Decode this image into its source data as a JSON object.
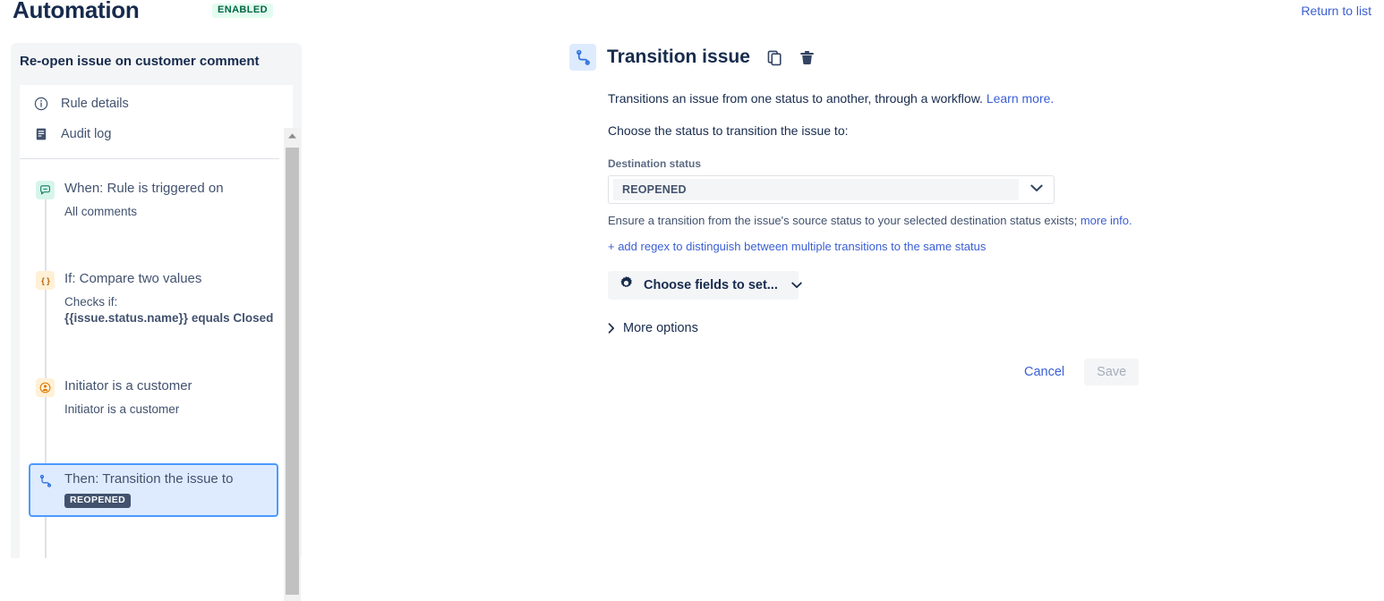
{
  "header": {
    "title": "Automation",
    "status_badge": "ENABLED",
    "return_link": "Return to list"
  },
  "sidebar": {
    "rule_name": "Re-open issue on customer comment",
    "nav": [
      {
        "label": "Rule details",
        "icon": "info-circle-icon"
      },
      {
        "label": "Audit log",
        "icon": "audit-log-icon"
      }
    ],
    "steps": [
      {
        "title": "When: Rule is triggered on",
        "subtitle": "All comments",
        "icon": "comment-icon",
        "selected": false
      },
      {
        "title": "If: Compare two values",
        "subtitle": "Checks if:",
        "detail": "{{issue.status.name}} equals Closed",
        "icon": "braces-icon",
        "selected": false
      },
      {
        "title": "Initiator is a customer",
        "subtitle": "Initiator is a customer",
        "icon": "person-icon",
        "selected": false
      },
      {
        "title": "Then: Transition the issue to",
        "lozenge": "REOPENED",
        "icon": "transition-icon",
        "selected": true
      }
    ]
  },
  "main": {
    "component_title": "Transition issue",
    "component_icon": "transition-icon",
    "copy_icon": "copy-icon",
    "delete_icon": "trash-icon",
    "description": "Transitions an issue from one status to another, through a workflow.",
    "description_link": "Learn more.",
    "choose_status_text": "Choose the status to transition the issue to:",
    "field_label": "Destination status",
    "destination_value": "REOPENED",
    "ensure_text": "Ensure a transition from the issue's source status to your selected destination status exists;",
    "ensure_link": "more info.",
    "add_regex_link": "+ add regex to distinguish between multiple transitions to the same status",
    "choose_fields_label": "Choose fields to set...",
    "more_options_label": "More options",
    "cancel_label": "Cancel",
    "save_label": "Save"
  },
  "colors": {
    "link": "#3b5fd4",
    "selected_step_bg": "#deebff",
    "selected_step_border": "#4c9aff",
    "enabled_badge_bg": "#e3fcef",
    "enabled_badge_text": "#006644",
    "lozenge_bg": "#42526e"
  }
}
